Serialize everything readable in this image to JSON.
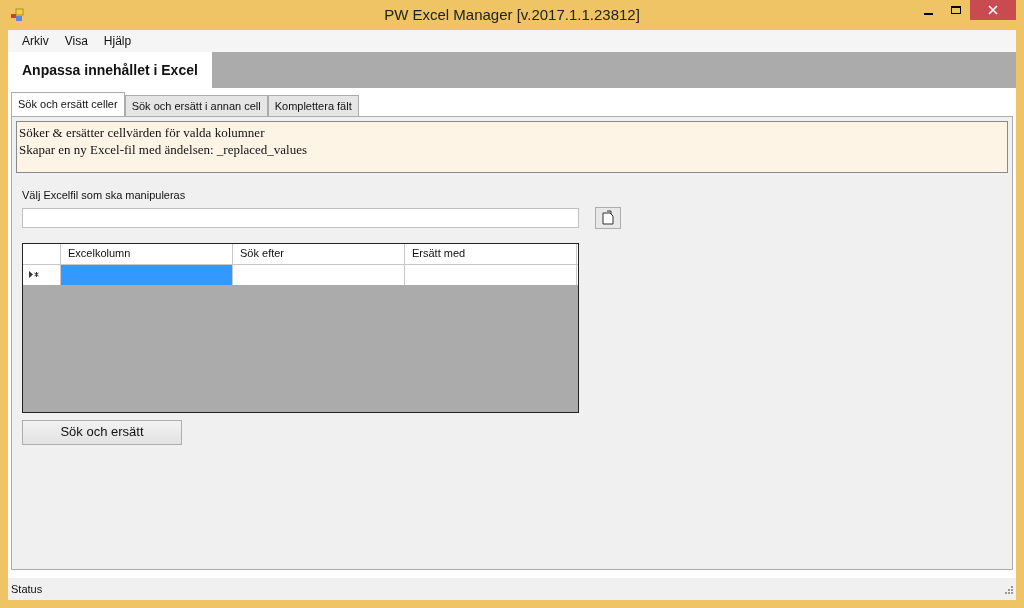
{
  "window": {
    "title": "PW Excel Manager [v.2017.1.1.23812]"
  },
  "menu": [
    "Arkiv",
    "Visa",
    "Hjälp"
  ],
  "main_tabs": [
    {
      "label": "Anpassa innehållet i Excel",
      "selected": true
    }
  ],
  "tabs": [
    {
      "label": "Sök och ersätt celler",
      "selected": true
    },
    {
      "label": "Sök och ersätt i annan cell",
      "selected": false
    },
    {
      "label": "Komplettera fält",
      "selected": false
    }
  ],
  "info": [
    "Söker & ersätter cellvärden för valda kolumner",
    "Skapar en ny Excel-fil med ändelsen: _replaced_values"
  ],
  "file_field": {
    "label": "Välj Excelfil som ska manipuleras"
  },
  "grid": {
    "columns": [
      "Excelkolumn",
      "Sök efter",
      "Ersätt med"
    ],
    "rows": [
      {
        "new_row": true,
        "cells": [
          {
            "selected": true
          },
          {
            "selected": false
          },
          {
            "selected": false
          }
        ]
      }
    ]
  },
  "button": "Sök och ersätt",
  "status_bar": "Status"
}
